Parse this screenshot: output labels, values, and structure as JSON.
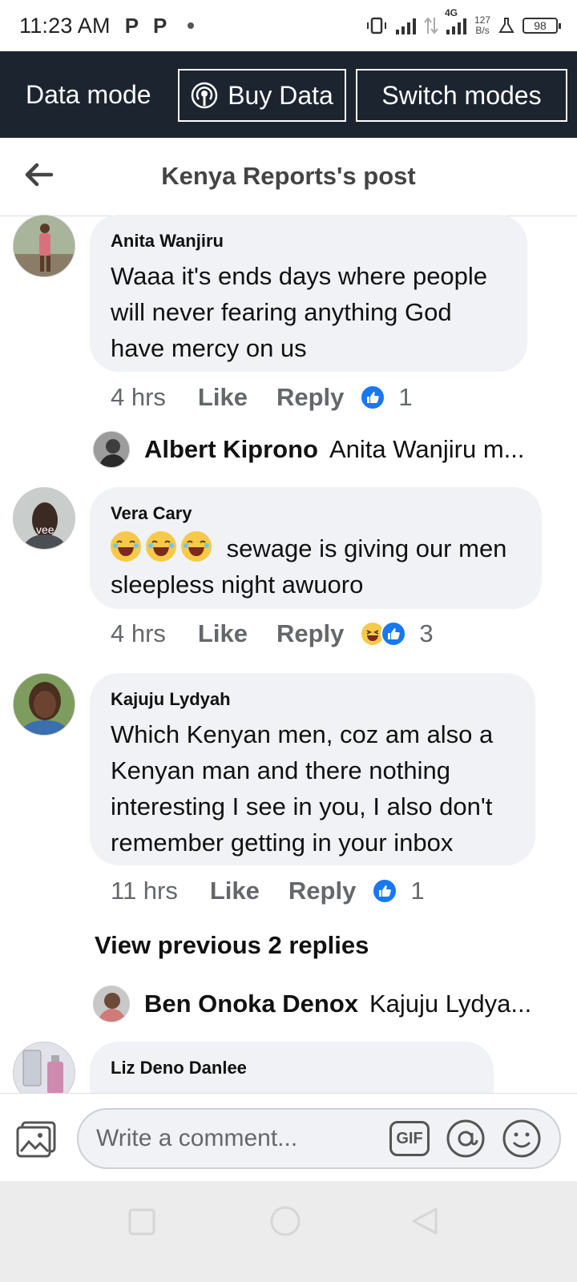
{
  "status_bar": {
    "time": "11:23 AM",
    "notif_icon_1": "P",
    "notif_icon_2": "P",
    "network_type": "4G",
    "net_speed_value": "127",
    "net_speed_unit": "B/s",
    "battery": "98"
  },
  "data_bar": {
    "label": "Data mode",
    "buy_label": "Buy Data",
    "switch_label": "Switch modes"
  },
  "header": {
    "title": "Kenya Reports's post"
  },
  "comments": [
    {
      "author": "Anita Wanjiru",
      "text": "Waaa it's ends days where people will never fearing anything God have mercy on us",
      "time": "4 hrs",
      "like": "Like",
      "reply": "Reply",
      "reaction_count": "1"
    },
    {
      "author": "Vera Cary",
      "text": "sewage is giving our men sleepless night awuoro",
      "time": "4 hrs",
      "like": "Like",
      "reply": "Reply",
      "reaction_count": "3"
    },
    {
      "author": "Kajuju Lydyah",
      "text": "Which Kenyan men, coz am also a Kenyan man and there nothing interesting I see in you, I also don't remember getting in your inbox",
      "time": "11 hrs",
      "like": "Like",
      "reply": "Reply",
      "reaction_count": "1"
    },
    {
      "author": "Liz Deno Danlee"
    }
  ],
  "replies": [
    {
      "author": "Albert Kiprono",
      "preview": "Anita Wanjiru m..."
    },
    {
      "author": "Ben Onoka Denox",
      "preview": "Kajuju Lydya..."
    }
  ],
  "view_previous": "View previous 2 replies",
  "vera_avatar_text": "vee",
  "composer": {
    "placeholder": "Write a comment...",
    "gif_label": "GIF"
  },
  "colors": {
    "data_bar_bg": "#1c2430",
    "bubble_bg": "#f0f2f5",
    "like_blue": "#1877f2"
  }
}
